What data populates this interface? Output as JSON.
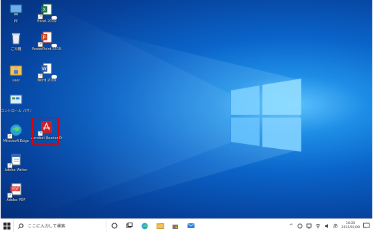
{
  "desktop": {
    "icons": [
      {
        "label": "PC"
      },
      {
        "label": "Excel 2019"
      },
      {
        "label": "ごみ箱"
      },
      {
        "label": "PowerPoint 2019"
      },
      {
        "label": "user"
      },
      {
        "label": "Word 2019"
      },
      {
        "label": "コントロール パネル"
      },
      {
        "label": "Microsoft Edge"
      },
      {
        "label": "Acrobat Reader DC"
      },
      {
        "label": "Adobe Writer"
      },
      {
        "label": "Adobe PDF"
      }
    ]
  },
  "taskbar": {
    "search_placeholder": "ここに入力して検索",
    "ime": "あ",
    "time": "16:22",
    "date": "2021/01/09"
  },
  "colors": {
    "desktop_dark": "#042f7a",
    "desktop_light": "#5fc3ff",
    "highlight": "#e00000",
    "taskbar": "#ffffff"
  }
}
